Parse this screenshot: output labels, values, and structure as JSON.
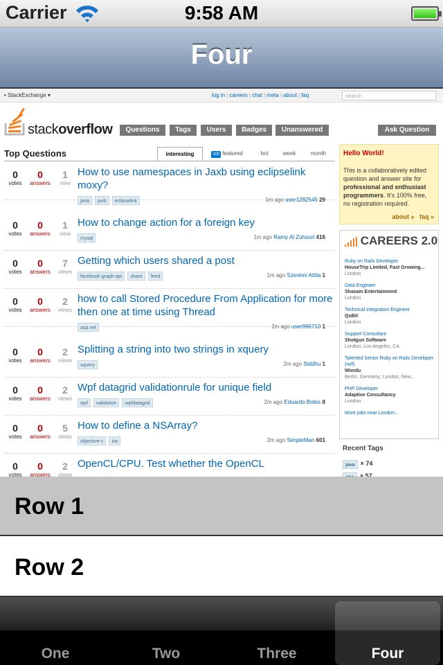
{
  "status_bar": {
    "carrier": "Carrier",
    "time": "9:58 AM"
  },
  "nav": {
    "title": "Four"
  },
  "web": {
    "se_logo": "StackExchange",
    "se_links": [
      "log in",
      "careers",
      "chat",
      "meta",
      "about",
      "faq"
    ],
    "search_placeholder": "search",
    "logo_text_a": "stack",
    "logo_text_b": "overflow",
    "nav_items": [
      "Questions",
      "Tags",
      "Users",
      "Badges",
      "Unanswered"
    ],
    "ask_button": "Ask Question",
    "section_title": "Top Questions",
    "tabs": {
      "active": "interesting",
      "featured_count": "300",
      "featured": "featured",
      "hot": "hot",
      "week": "week",
      "month": "month"
    },
    "stat_labels": {
      "votes": "votes",
      "answers": "answers",
      "view": "view",
      "views": "views"
    },
    "questions": [
      {
        "votes": "0",
        "answers": "0",
        "views": "1",
        "views_label": "view",
        "title": "How to use namespaces in Jaxb using eclipselink moxy?",
        "tags": [
          "java",
          "jaxb",
          "eclipselink"
        ],
        "time": "1m ago",
        "user": "user1282545",
        "rep": "29"
      },
      {
        "votes": "0",
        "answers": "0",
        "views": "1",
        "views_label": "view",
        "title": "How to change action for a foreign key",
        "tags": [
          "mysql"
        ],
        "time": "1m ago",
        "user": "Ramy Al Zuhouri",
        "rep": "416"
      },
      {
        "votes": "0",
        "answers": "0",
        "views": "7",
        "views_label": "views",
        "title": "Getting which users shared a post",
        "tags": [
          "facebook-graph-api",
          "share",
          "feed"
        ],
        "time": "1m ago",
        "user": "Szerémi Attila",
        "rep": "1"
      },
      {
        "votes": "0",
        "answers": "0",
        "views": "2",
        "views_label": "views",
        "title": "how to call Stored Procedure From Application for more then one at time using Thread",
        "tags": [
          "asp.net"
        ],
        "time": "2m ago",
        "user": "user996710",
        "rep": "1"
      },
      {
        "votes": "0",
        "answers": "0",
        "views": "2",
        "views_label": "views",
        "title": "Splitting a string into two strings in xquery",
        "tags": [
          "xquery"
        ],
        "time": "2m ago",
        "user": "Siddhu",
        "rep": "1"
      },
      {
        "votes": "0",
        "answers": "0",
        "views": "2",
        "views_label": "views",
        "title": "Wpf datagrid validationrule for unique field",
        "tags": [
          "wpf",
          "validation",
          "wpfdatagrid"
        ],
        "time": "2m ago",
        "user": "Eduardo Brites",
        "rep": "8"
      },
      {
        "votes": "0",
        "answers": "0",
        "views": "5",
        "views_label": "views",
        "title": "How to define a NSArray?",
        "tags": [
          "objective-c",
          "ios"
        ],
        "time": "2m ago",
        "user": "SimpleMan",
        "rep": "601"
      },
      {
        "votes": "0",
        "answers": "0",
        "views": "2",
        "views_label": "views",
        "title": "OpenCL/CPU. Test whether the OpenCL",
        "tags": [],
        "time": "",
        "user": "",
        "rep": ""
      }
    ],
    "hello": {
      "title": "Hello World!",
      "text_a": "This is a collaboratively edited question and answer site for ",
      "text_b": "professional and enthusiast programmers",
      "text_c": ". It's 100% free, no registration required.",
      "about": "about »",
      "faq": "faq »"
    },
    "careers": {
      "title": "CAREERS 2.0",
      "jobs": [
        {
          "title": "Ruby on Rails Developer",
          "company": "HouseTrip Limited, Fast Growing...",
          "location": "London"
        },
        {
          "title": "Data Engineer",
          "company": "Shazam Entertainment",
          "location": "London"
        },
        {
          "title": "Technical Integration Engineer",
          "company": "QuBit",
          "location": "London"
        },
        {
          "title": "Support Consultant",
          "company": "Shotgun Software",
          "location": "London; Los Angeles, CA"
        },
        {
          "title": "Talented Senior Ruby on Rails Developer (m/f)",
          "company": "Wimdu",
          "location": "Berlin, Germany; London; New..."
        },
        {
          "title": "PHP Developer",
          "company": "Adaptive Consultancy",
          "location": "London"
        }
      ],
      "more": "More jobs near London..."
    },
    "recent_tags": {
      "title": "Recent Tags",
      "items": [
        {
          "name": "java",
          "count": "× 74"
        },
        {
          "name": "php",
          "count": "× 57"
        }
      ]
    }
  },
  "table": {
    "rows": [
      "Row 1",
      "Row 2"
    ]
  },
  "tabbar": {
    "items": [
      "One",
      "Two",
      "Three",
      "Four"
    ],
    "selected": "Four"
  }
}
